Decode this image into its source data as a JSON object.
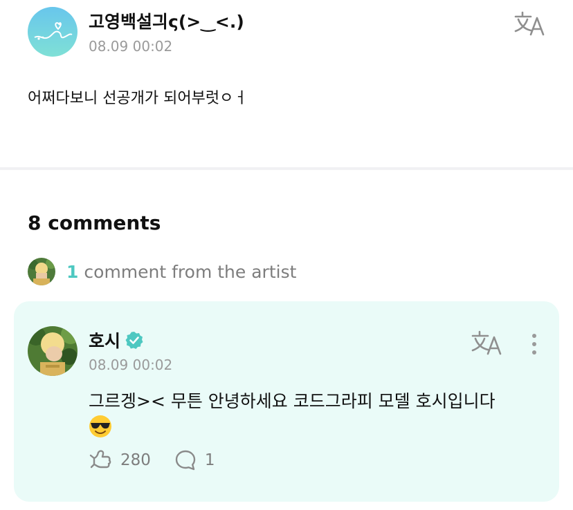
{
  "post": {
    "author": "고영백설긔ς(>‿<.)",
    "time": "08.09 00:02",
    "body": "어쩌다보니 선공개가 되어부럿ㅇㅓ"
  },
  "comments_section": {
    "heading": "8 comments",
    "artist_count": "1",
    "artist_text": "comment from the artist"
  },
  "artist_comment": {
    "author": "호시",
    "time": "08.09 00:02",
    "body": "그르겡>< 무튼 안녕하세요 코드그라피 모델 호시입니다",
    "likes": "280",
    "replies": "1"
  },
  "icons": {
    "translate": "translate-icon",
    "verified": "verified-badge-icon",
    "more": "more-vertical-icon",
    "like": "like-icon",
    "comment": "comment-icon",
    "emoji": "sunglasses-emoji"
  },
  "colors": {
    "accent": "#4ec8c1",
    "card_bg": "#eafbf8",
    "muted": "#9a9a9a"
  }
}
